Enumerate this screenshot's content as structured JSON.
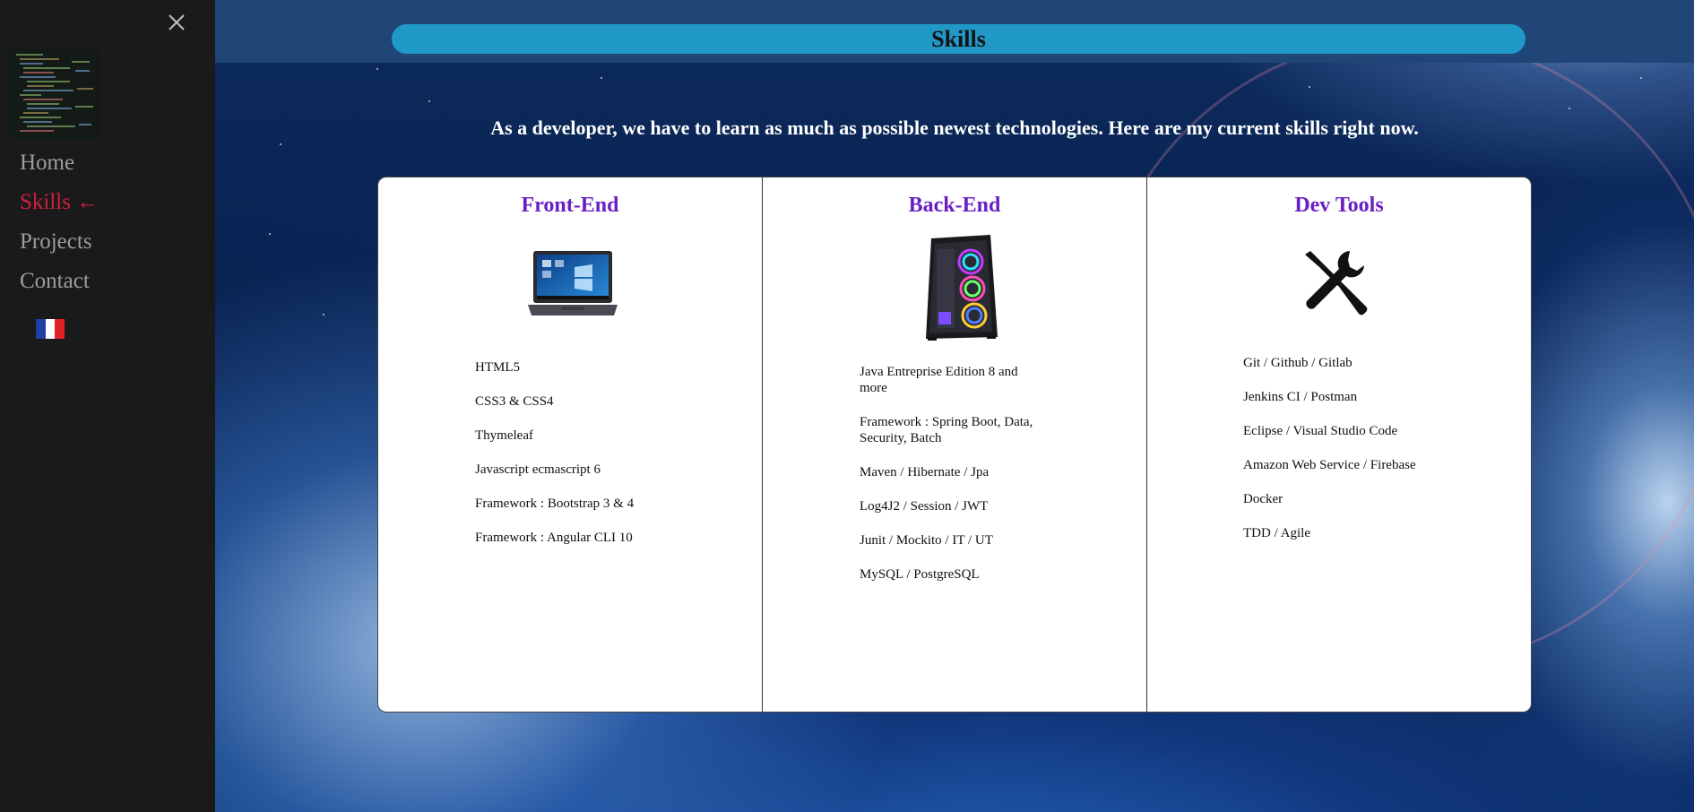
{
  "sidebar": {
    "nav": [
      {
        "label": "Home",
        "active": false
      },
      {
        "label": "Skills ←",
        "active": true
      },
      {
        "label": "Projects",
        "active": false
      },
      {
        "label": "Contact",
        "active": false
      }
    ],
    "active_color": "#d21f3c",
    "close_icon": "close-icon",
    "language_flag": "flag-fr-icon"
  },
  "header": {
    "title": "Skills"
  },
  "intro": "As a developer, we have to learn as much as possible newest technologies. Here are my current skills right now.",
  "columns": [
    {
      "title": "Front-End",
      "icon": "laptop-icon",
      "items": [
        "HTML5",
        "CSS3 & CSS4",
        "Thymeleaf",
        "Javascript ecmascript 6",
        "Framework : Bootstrap 3 & 4",
        "Framework : Angular CLI 10"
      ]
    },
    {
      "title": "Back-End",
      "icon": "desktop-tower-icon",
      "items": [
        "Java Entreprise Edition 8 and more",
        "Framework : Spring Boot, Data, Security, Batch",
        "Maven / Hibernate / Jpa",
        "Log4J2 / Session / JWT",
        "Junit / Mockito / IT / UT",
        "MySQL / PostgreSQL"
      ]
    },
    {
      "title": "Dev Tools",
      "icon": "tools-icon",
      "items": [
        "Git / Github / Gitlab",
        "Jenkins CI / Postman",
        "Eclipse / Visual Studio Code",
        "Amazon Web Service / Firebase",
        "Docker",
        "TDD / Agile"
      ]
    }
  ],
  "colors": {
    "title_pill": "#2199c7",
    "column_title": "#6a1fc4",
    "sidebar_bg": "#1b1a1a"
  }
}
